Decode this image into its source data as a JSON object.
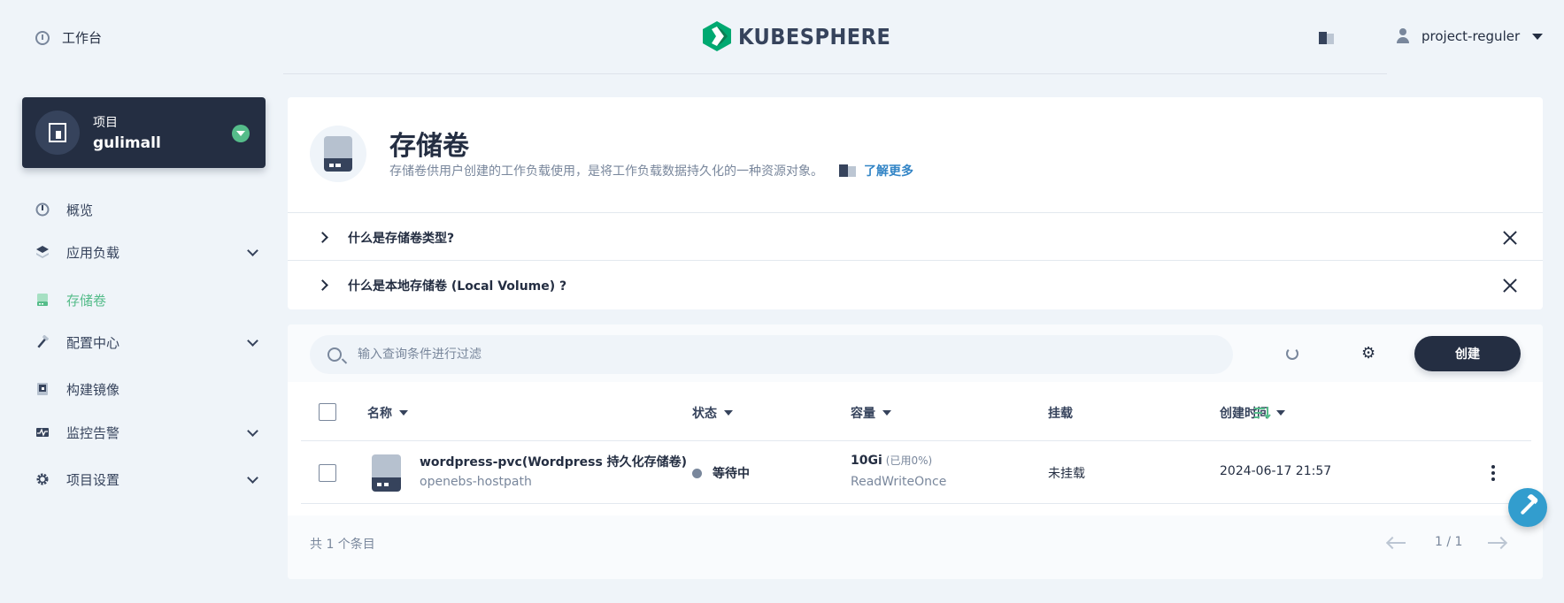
{
  "topbar": {
    "workbench_label": "工作台",
    "logo_text": "KUBESPHERE",
    "username": "project-reguler"
  },
  "project": {
    "label": "项目",
    "name": "gulimall"
  },
  "sidebar": {
    "items": [
      {
        "label": "概览",
        "icon": "dashboard-icon",
        "expandable": false,
        "active": false
      },
      {
        "label": "应用负载",
        "icon": "layers-icon",
        "expandable": true,
        "active": false
      },
      {
        "label": "存储卷",
        "icon": "storage-icon",
        "expandable": false,
        "active": true
      },
      {
        "label": "配置中心",
        "icon": "hammer-icon",
        "expandable": true,
        "active": false
      },
      {
        "label": "构建镜像",
        "icon": "image-icon",
        "expandable": false,
        "active": false
      },
      {
        "label": "监控告警",
        "icon": "monitor-icon",
        "expandable": true,
        "active": false
      },
      {
        "label": "项目设置",
        "icon": "gear-icon",
        "expandable": true,
        "active": false
      }
    ]
  },
  "header": {
    "title": "存储卷",
    "description": "存储卷供用户创建的工作负载使用，是将工作负载数据持久化的一种资源对象。",
    "learn_more": "了解更多",
    "faqs": [
      "什么是存储卷类型?",
      "什么是本地存储卷 (Local Volume) ?"
    ]
  },
  "toolbar": {
    "search_placeholder": "输入查询条件进行过滤",
    "create_label": "创建"
  },
  "table": {
    "columns": [
      "名称",
      "状态",
      "容量",
      "挂载",
      "创建时间"
    ],
    "rows": [
      {
        "name": "wordpress-pvc(Wordpress 持久化存储卷)",
        "storage_class": "openebs-hostpath",
        "status": "等待中",
        "capacity": "10Gi",
        "usage": "(已用0%)",
        "access_mode": "ReadWriteOnce",
        "mount": "未挂载",
        "created": "2024-06-17 21:57"
      }
    ]
  },
  "pagination": {
    "total": "共 1 个条目",
    "page": "1 / 1"
  },
  "colors": {
    "accent": "#55bc8a",
    "dark": "#242e42",
    "background": "#eff4f9",
    "link": "#3385c6"
  }
}
